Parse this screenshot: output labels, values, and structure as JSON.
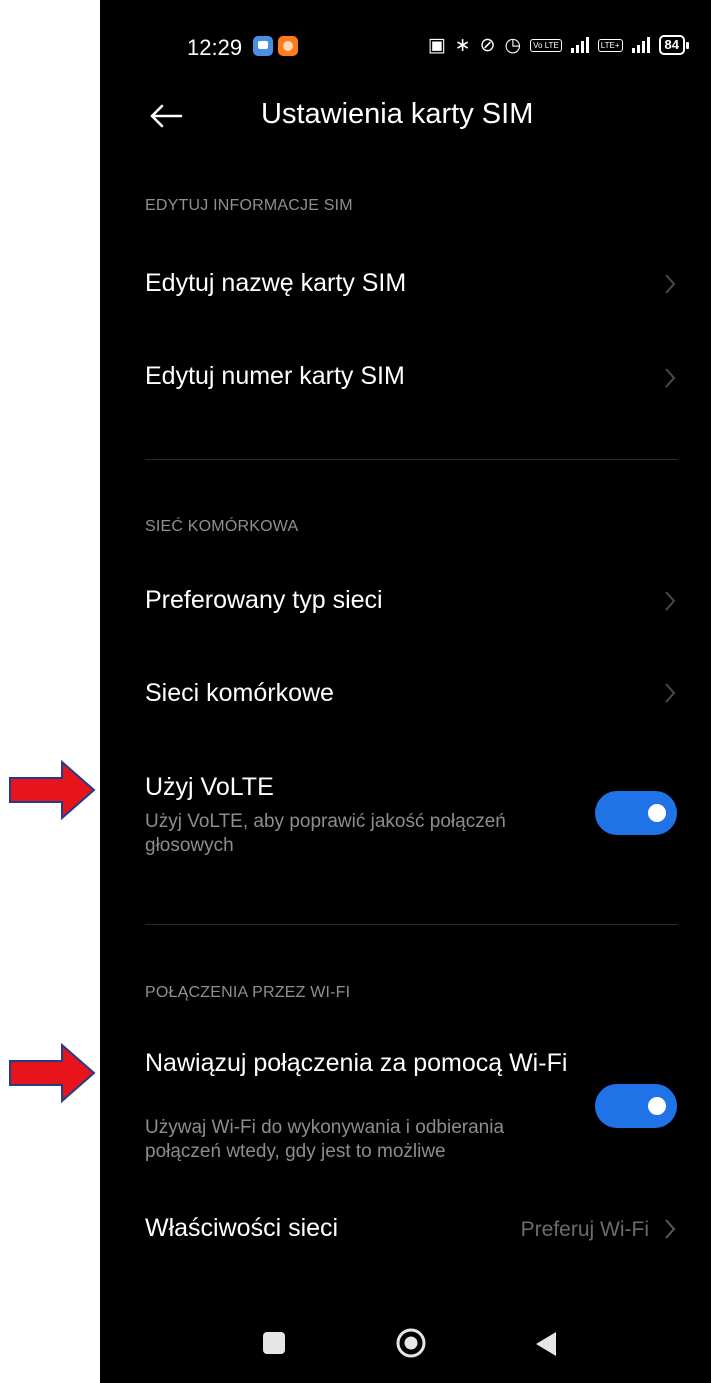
{
  "status_bar": {
    "time": "12:29",
    "battery": "84",
    "network_label": "LTE+",
    "volte_badge": "Vo LTE"
  },
  "header": {
    "title": "Ustawienia karty SIM"
  },
  "sections": {
    "sim_info": {
      "header": "EDYTUJ INFORMACJE SIM",
      "edit_name": "Edytuj nazwę karty SIM",
      "edit_number": "Edytuj numer karty SIM"
    },
    "mobile": {
      "header": "SIEĆ KOMÓRKOWA",
      "preferred_network": "Preferowany typ sieci",
      "mobile_networks": "Sieci komórkowe",
      "volte_title": "Użyj VoLTE",
      "volte_desc": "Użyj VoLTE, aby poprawić jakość połączeń głosowych",
      "volte_enabled": true
    },
    "wifi_calling": {
      "header": "POŁĄCZENIA PRZEZ WI-FI",
      "wifi_title": "Nawiązuj połączenia za pomocą Wi-Fi",
      "wifi_desc": "Używaj Wi-Fi do wykonywania i odbierania połączeń wtedy, gdy jest to możliwe",
      "wifi_enabled": true,
      "network_props_title": "Właściwości sieci",
      "network_props_value": "Preferuj Wi-Fi"
    }
  },
  "colors": {
    "background": "#000000",
    "accent": "#1f73e6",
    "annotation_arrow": "#e8141c"
  }
}
